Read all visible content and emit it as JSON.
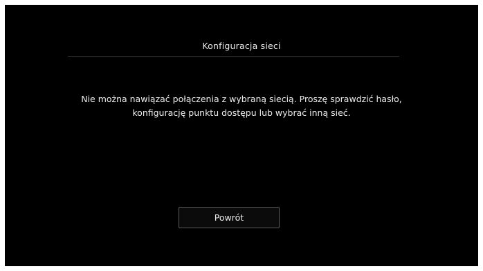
{
  "dialog": {
    "title": "Konfiguracja sieci",
    "message_line1": "Nie można nawiązać połączenia z wybraną siecią. Proszę sprawdzić hasło,",
    "message_line2": "konfigurację punktu dostępu lub wybrać inną sieć.",
    "back_label": "Powrót"
  },
  "colors": {
    "background": "#000000",
    "text": "#e6e6e6",
    "divider": "#3a3a3a",
    "button_border": "#5a5a5a"
  }
}
